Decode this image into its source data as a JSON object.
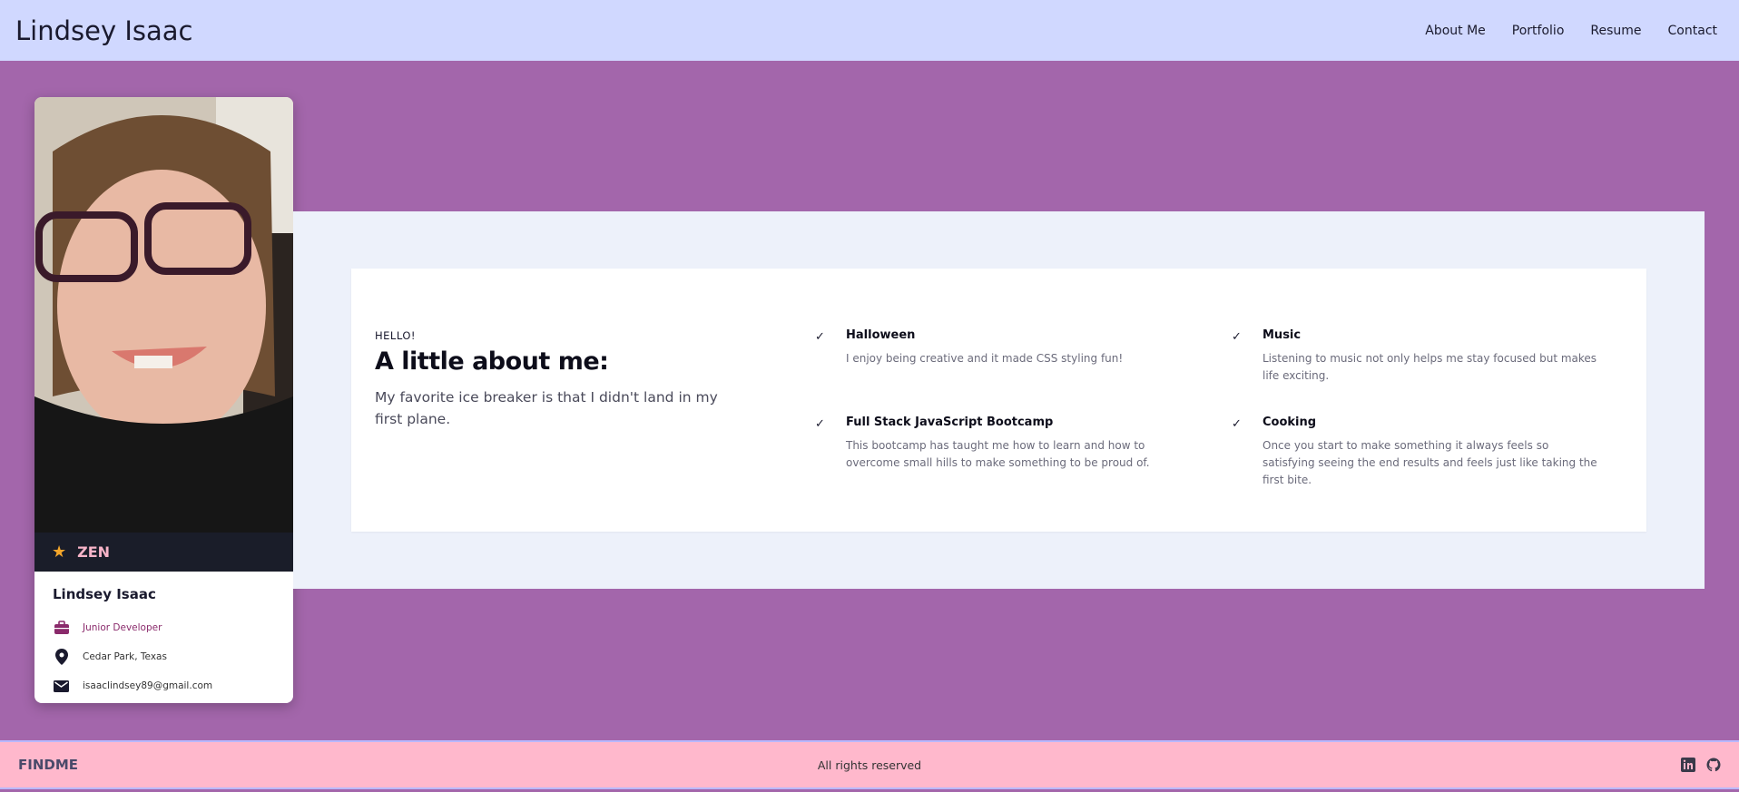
{
  "header": {
    "brand": "Lindsey Isaac",
    "nav": [
      {
        "label": "About Me"
      },
      {
        "label": "Portfolio"
      },
      {
        "label": "Resume"
      },
      {
        "label": "Contact"
      }
    ]
  },
  "profile": {
    "badge": "ZEN",
    "badge_icon": "star-icon",
    "name": "Lindsey Isaac",
    "title": "Junior Developer",
    "location": "Cedar Park, Texas",
    "email": "isaaclindsey89@gmail.com"
  },
  "about": {
    "eyebrow": "HELLO!",
    "title": "A little about me:",
    "description": "My favorite ice breaker is that I didn't land in my first plane.",
    "features": [
      {
        "title": "Halloween",
        "desc": "I enjoy being creative and it made CSS styling fun!"
      },
      {
        "title": "Music",
        "desc": "Listening to music not only helps me stay focused but makes life exciting."
      },
      {
        "title": "Full Stack JavaScript Bootcamp",
        "desc": "This bootcamp has taught me how to learn and how to overcome small hills to make something to be proud of."
      },
      {
        "title": "Cooking",
        "desc": "Once you start to make something it always feels so satisfying seeing the end results and feels just like taking the first bite."
      }
    ]
  },
  "footer": {
    "brand": "FINDME",
    "text": "All rights reserved",
    "icons": [
      "linkedin-icon",
      "github-icon"
    ]
  },
  "colors": {
    "page_bg": "#a366ab",
    "nav_bg": "#d0d8ff",
    "footer_bg": "#ffb8cc",
    "badge_star": "#f4a62a",
    "badge_text": "#f7b4c8",
    "job_color": "#8a2a6b"
  }
}
